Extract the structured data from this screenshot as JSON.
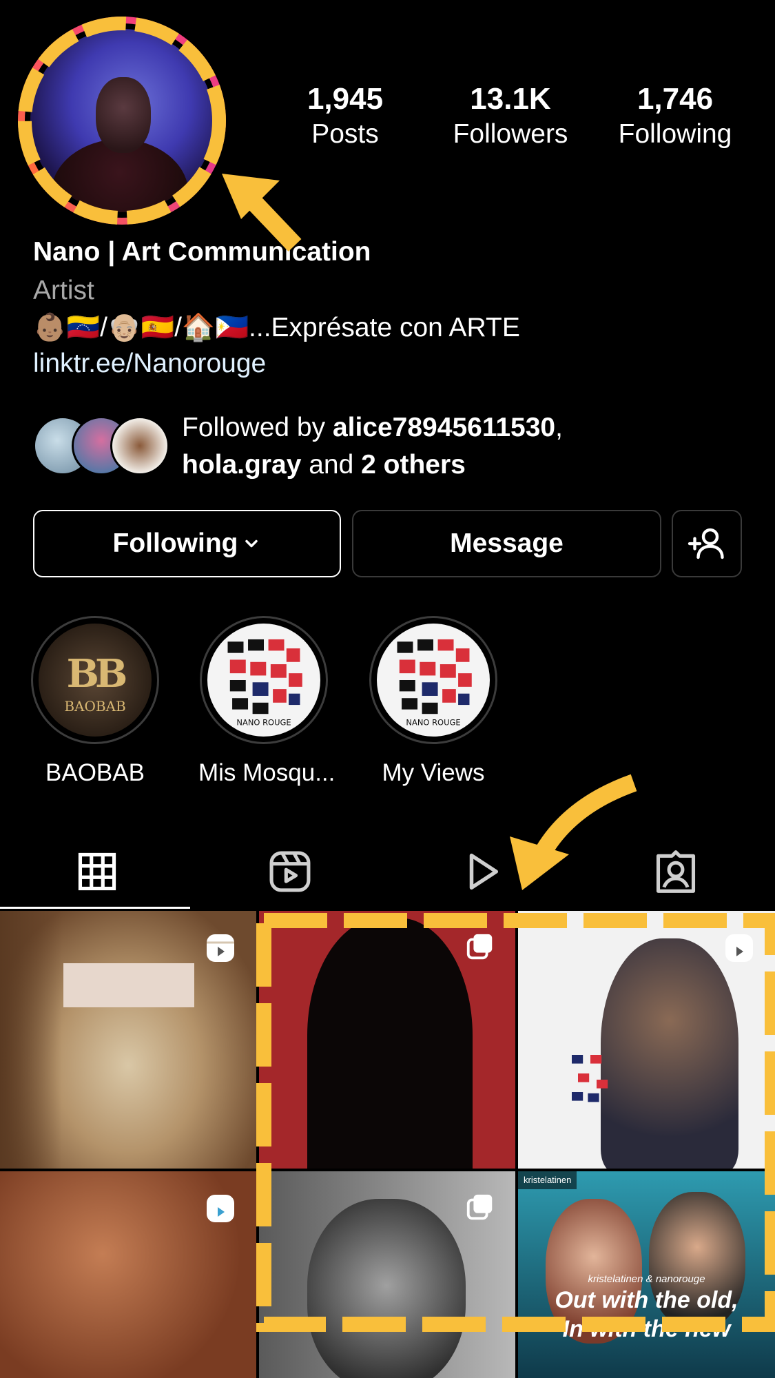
{
  "profile": {
    "stats": [
      {
        "value": "1,945",
        "label": "Posts"
      },
      {
        "value": "13.1K",
        "label": "Followers"
      },
      {
        "value": "1,746",
        "label": "Following"
      }
    ],
    "name": "Nano | Art Communication",
    "category": "Artist",
    "bio": "👶🏽🇻🇪/👴🏼🇪🇸/🏠🇵🇭...Exprésate con ARTE",
    "link": "linktr.ee/Nanorouge"
  },
  "followed_by": {
    "prefix": "Followed by ",
    "user1": "alice78945611530",
    "comma": ",",
    "user2": "hola.gray",
    "and": " and ",
    "others": "2 others"
  },
  "buttons": {
    "following": "Following",
    "message": "Message"
  },
  "highlights": [
    {
      "label": "BAOBAB",
      "mark": "BB",
      "sub": "BAOBAB"
    },
    {
      "label": "Mis Mosqu...",
      "caption": "NANO ROUGE"
    },
    {
      "label": "My Views",
      "caption": "NANO ROUGE"
    }
  ],
  "grid": {
    "repost_user": "kristelatinen",
    "post6_script": "kristelatinen & nanorouge",
    "post6_title": "Out with the old,",
    "post6_title2": "In with the new"
  },
  "colors": {
    "annotation": "#f9bf3b",
    "background": "#000000",
    "story_ring": "#f5407a"
  }
}
